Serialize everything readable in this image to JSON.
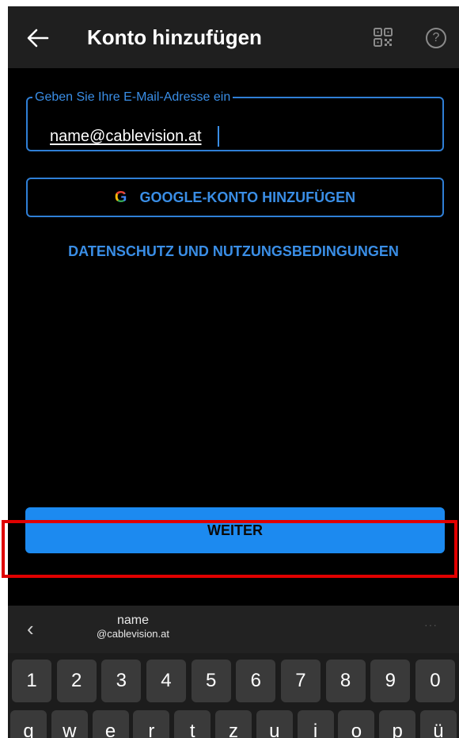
{
  "app_bar": {
    "title": "Konto hinzufügen",
    "back_icon": "arrow-left-icon",
    "qr_icon": "qr-code-icon",
    "help_icon": "help-circle-icon",
    "help_glyph": "?"
  },
  "email_field": {
    "label": "Geben Sie Ihre E-Mail-Adresse ein",
    "value": "name@cablevision.at"
  },
  "google_button": {
    "icon_letter": "G",
    "label": "GOOGLE-KONTO HINZUFÜGEN"
  },
  "privacy_link": "DATENSCHUTZ UND NUTZUNGSBEDINGUNGEN",
  "continue_button": {
    "label": "WEITER"
  },
  "keyboard": {
    "back_glyph": "‹",
    "suggestion_line1": "name",
    "suggestion_line2": "@cablevision.at",
    "more_glyph": "···",
    "number_row": [
      "1",
      "2",
      "3",
      "4",
      "5",
      "6",
      "7",
      "8",
      "9",
      "0"
    ],
    "letter_row": [
      "q",
      "w",
      "e",
      "r",
      "t",
      "z",
      "u",
      "i",
      "o",
      "p",
      "ü"
    ]
  },
  "colors": {
    "accent": "#1c8af0",
    "link": "#3a8ee6",
    "background": "#000000",
    "app_bar": "#1f1f1f",
    "highlight": "#e00000"
  }
}
